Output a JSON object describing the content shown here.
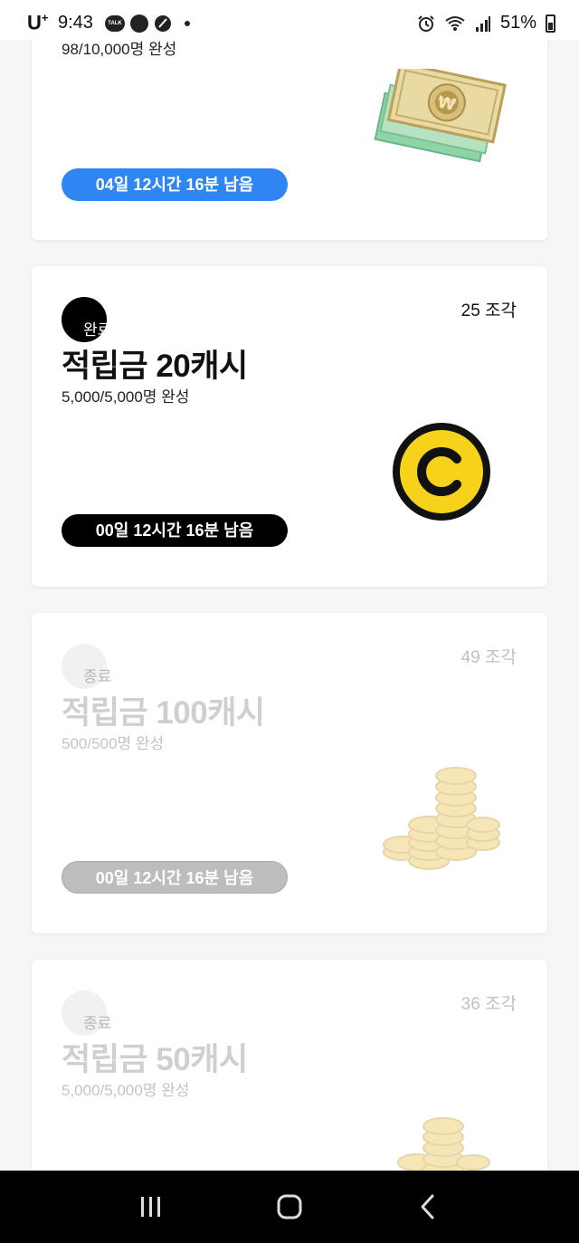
{
  "status_bar": {
    "carrier": "U",
    "carrier_sup": "+",
    "time": "9:43",
    "talk_label": "TALK",
    "battery": "51%"
  },
  "cards": [
    {
      "progress": "98/10,000명 완성",
      "timer": "04일 12시간 16분 남음",
      "timer_color": "#2f86f2",
      "illustration": "banknotes-icon"
    },
    {
      "pieces": "25 조각",
      "badge": "완료",
      "title": "적립금 20캐시",
      "progress": "5,000/5,000명 완성",
      "timer": "00일 12시간 16분 남음",
      "timer_color": "#000000",
      "illustration": "coin-c-icon"
    },
    {
      "pieces": "49 조각",
      "badge": "종료",
      "title": "적립금 100캐시",
      "progress": "500/500명 완성",
      "timer": "00일 12시간 16분 남음",
      "timer_color": "#bdbdbd",
      "illustration": "gold-coins-icon"
    },
    {
      "pieces": "36 조각",
      "badge": "종료",
      "title": "적립금 50캐시",
      "progress": "5,000/5,000명 완성",
      "illustration": "gold-coins-icon"
    }
  ],
  "nav": {
    "recent": "recent-apps-icon",
    "home": "home-icon",
    "back": "back-icon"
  }
}
